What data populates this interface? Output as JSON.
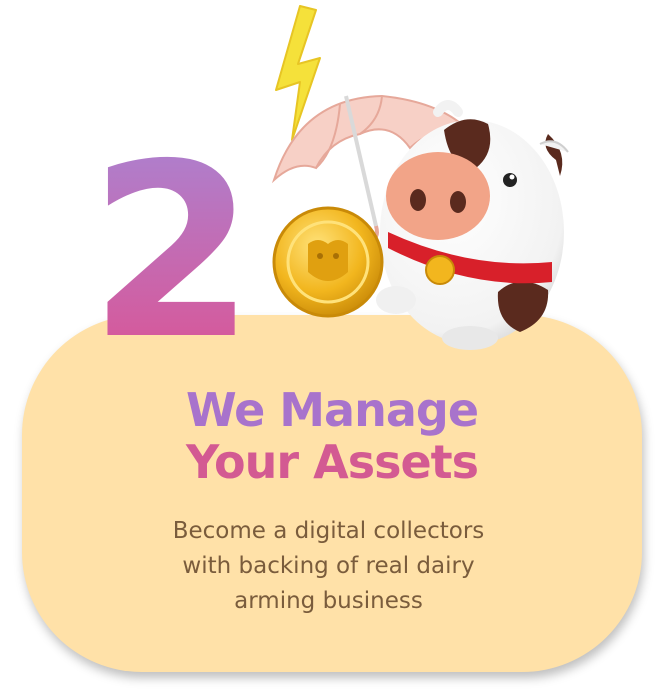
{
  "step": {
    "number": "2"
  },
  "heading": {
    "line1": "We Manage",
    "line2": "Your Assets"
  },
  "description": {
    "lines": [
      "Become a digital collectors",
      "with backing of real dairy",
      "arming business"
    ]
  },
  "colors": {
    "card": "#ffe1a8",
    "number_top": "#a786d6",
    "number_bottom": "#e0508f",
    "heading_line1": "#a873cc",
    "heading_line2": "#d35a92",
    "description": "#7a5c3c",
    "coin": "#f2b61e",
    "lightning": "#f5e13a",
    "umbrella": "#f7d0c6",
    "collar": "#d8202a",
    "cow_spot": "#5a2a1e",
    "cow_nose": "#f2a488"
  },
  "icons": [
    "lightning-icon",
    "umbrella-icon",
    "coin-icon",
    "cow-mascot-icon"
  ]
}
